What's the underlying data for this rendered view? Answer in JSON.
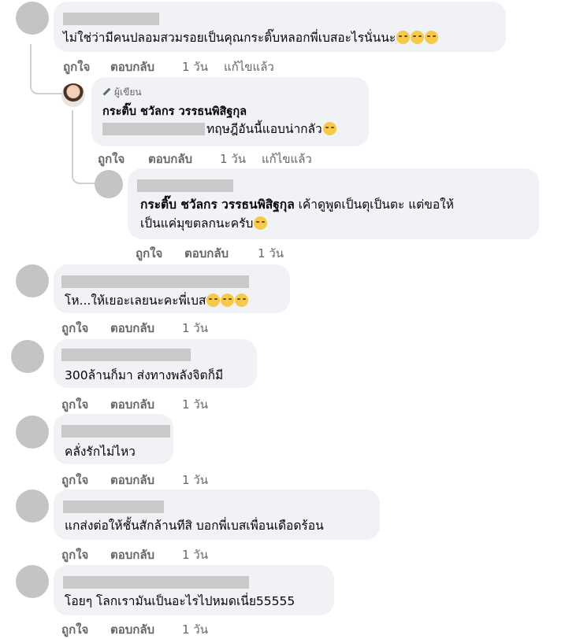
{
  "actions": {
    "like": "ถูกใจ",
    "reply": "ตอบกลับ",
    "edited": "แก้ไขแล้ว"
  },
  "author_tag": "ผู้เขียน",
  "comments": [
    {
      "time": "1 วัน",
      "text": "ไม่ใช่ว่ามีคนปลอมสวมรอยเป็นคุณกระติ๊บหลอกพี่เบสอะไรนั่นนะ",
      "emoji": [
        "pensive-face",
        "pensive-face",
        "pensive-face"
      ],
      "edited": true
    },
    {
      "time": "1 วัน",
      "author": "กระติ๊บ ชวัลกร วรรธนพิสิฐกุล",
      "text": "ทฤษฎีอันนี้แอบน่ากลัว",
      "emoji": [
        "sweat-face"
      ],
      "edited": true
    },
    {
      "time": "1 วัน",
      "mention": "กระติ๊บ ชวัลกร วรรธนพิสิฐกุล",
      "text_line1": "เค้าดูพูดเป็นตุเป็นตะ แต่ขอให้",
      "text_line2": "เป็นแค่มุขตลกนะครับ",
      "emoji": [
        "grin-sweat-face"
      ]
    },
    {
      "time": "1 วัน",
      "text": "โห...ให้เยอะเลยนะคะพี่เบส",
      "emoji": [
        "rofl-face",
        "rofl-face",
        "rofl-face"
      ]
    },
    {
      "time": "1 วัน",
      "text": "300ล้านก็มา ส่งทางพลังจิตก็มี"
    },
    {
      "time": "1 วัน",
      "text": "คลั่งรักไม่ไหว"
    },
    {
      "time": "1 วัน",
      "text": "แกส่งต่อให้ชั้นสักล้านทีสิ บอกพี่เบสเพื่อนเดือดร้อน"
    },
    {
      "time": "1 วัน",
      "text": "โอยๆ โลกเรามันเป็นอะไรไปหมดเนี่ย55555"
    }
  ]
}
